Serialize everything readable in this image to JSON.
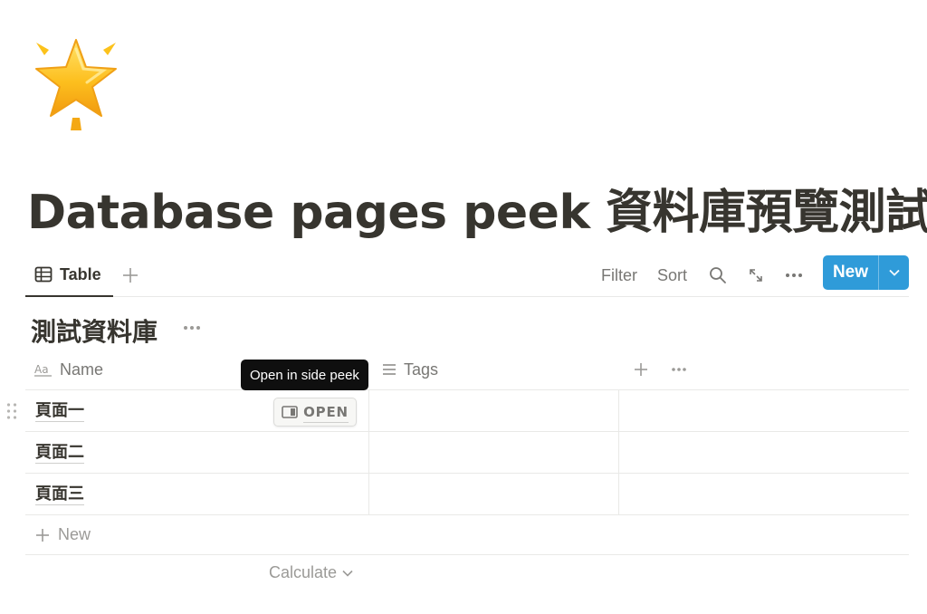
{
  "page": {
    "icon": "glowing-star-icon",
    "title": "Database pages peek 資料庫預覽測試"
  },
  "view_bar": {
    "tabs": [
      {
        "label": "Table",
        "icon": "table-icon",
        "active": true
      }
    ],
    "add_view_icon": "plus-icon",
    "tools": {
      "filter": "Filter",
      "sort": "Sort",
      "search_icon": "search-icon",
      "expand_icon": "expand-icon",
      "more_icon": "more-icon"
    },
    "new_button": {
      "label": "New",
      "dropdown_icon": "chevron-down-icon",
      "color": "#2f9bd9"
    }
  },
  "database": {
    "title": "測試資料庫",
    "more_icon": "more-icon",
    "columns": [
      {
        "label": "Name",
        "icon": "text-aa-icon"
      },
      {
        "label": "Tags",
        "icon": "list-icon"
      }
    ],
    "rows": [
      {
        "name": "頁面一"
      },
      {
        "name": "頁面二"
      },
      {
        "name": "頁面三"
      }
    ],
    "new_row_label": "New",
    "calculate_label": "Calculate"
  },
  "hover": {
    "open_button_label": "OPEN",
    "tooltip": "Open in side peek"
  }
}
